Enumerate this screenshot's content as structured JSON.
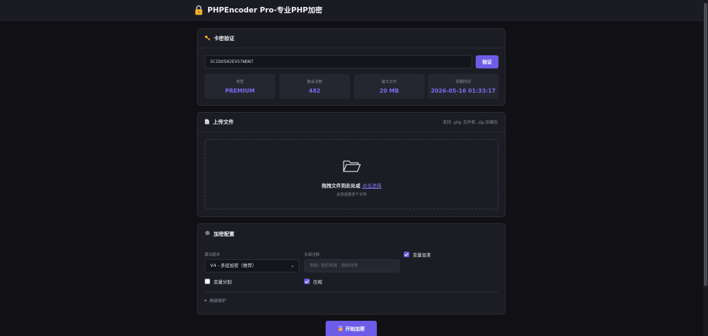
{
  "header": {
    "title": "PHPEncoder Pro-专业PHP加密",
    "logo_icon": "lock-icon"
  },
  "verify": {
    "title": "卡密验证",
    "icon": "key-icon",
    "key_value": "5CIDO5H2EV57WDN7",
    "button_label": "验证",
    "stats": [
      {
        "label": "类型",
        "value": "PREMIUM"
      },
      {
        "label": "剩余次数",
        "value": "482"
      },
      {
        "label": "最大文件",
        "value": "20 MB"
      },
      {
        "label": "到期时间",
        "value": "2026-05-16 01:33:17"
      }
    ]
  },
  "upload": {
    "title": "上传文件",
    "icon": "document-icon",
    "note": "支持 .php 文件和 .zip 压缩包",
    "drop_text": "拖拽文件到此处或",
    "drop_link": "点击选择",
    "drop_sub": "支持选择多个文件"
  },
  "config": {
    "title": "加密配置",
    "icon": "gear-icon",
    "algorithm_label": "算法版本",
    "algorithm_value": "V4 - 多层加密（推荐）",
    "header_comment_label": "头部注释",
    "header_comment_placeholder": "例如: 我的项目 - 版权所有",
    "checkboxes": [
      {
        "label": "变量混淆",
        "checked": true
      },
      {
        "label": "变量分割",
        "checked": false
      },
      {
        "label": "压缩",
        "checked": true
      }
    ],
    "advanced_label": "高级保护"
  },
  "start_button_label": "开始加密",
  "colors": {
    "accent": "#6d5ce8",
    "background": "#111115",
    "card": "#1c1d24"
  }
}
